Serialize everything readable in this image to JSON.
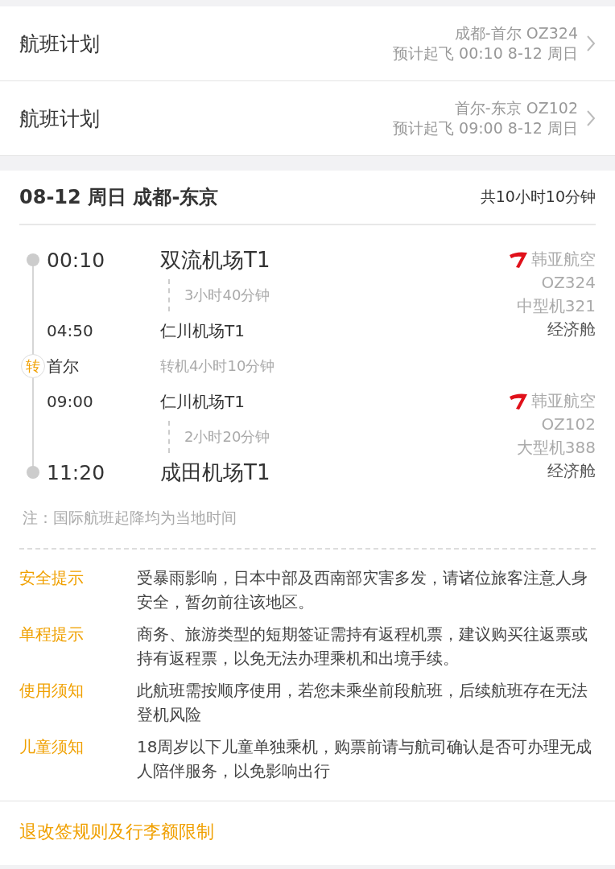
{
  "flight_plans": [
    {
      "title": "航班计划",
      "route": "成都-首尔 OZ324",
      "departure": "预计起飞 00:10 8-12 周日"
    },
    {
      "title": "航班计划",
      "route": "首尔-东京 OZ102",
      "departure": "预计起飞 09:00 8-12 周日"
    }
  ],
  "summary": {
    "date_route": "08-12 周日 成都-东京",
    "total": "共10小时10分钟"
  },
  "segments": [
    {
      "departure": {
        "time": "00:10",
        "airport": "双流机场T1"
      },
      "duration": "3小时40分钟",
      "arrival": {
        "time": "04:50",
        "airport": "仁川机场T1"
      },
      "airline": "韩亚航空",
      "flight_no": "OZ324",
      "aircraft": "中型机321",
      "cabin": "经济舱"
    },
    {
      "departure": {
        "time": "09:00",
        "airport": "仁川机场T1"
      },
      "duration": "2小时20分钟",
      "arrival": {
        "time": "11:20",
        "airport": "成田机场T1"
      },
      "airline": "韩亚航空",
      "flight_no": "OZ102",
      "aircraft": "大型机388",
      "cabin": "经济舱"
    }
  ],
  "transfer": {
    "badge": "转",
    "city": "首尔",
    "duration": "转机4小时10分钟"
  },
  "note": "注：国际航班起降均为当地时间",
  "notices": [
    {
      "label": "安全提示",
      "text": "受暴雨影响，日本中部及西南部灾害多发，请诸位旅客注意人身安全，暂勿前往该地区。"
    },
    {
      "label": "单程提示",
      "text": "商务、旅游类型的短期签证需持有返程机票，建议购买往返票或持有返程票，以免无法办理乘机和出境手续。"
    },
    {
      "label": "使用须知",
      "text": "此航班需按顺序使用，若您未乘坐前段航班，后续航班存在无法登机风险"
    },
    {
      "label": "儿童须知",
      "text": "18周岁以下儿童单独乘机，购票前请与航司确认是否可办理无成人陪伴服务，以免影响出行"
    }
  ],
  "footer_link": "退改签规则及行李额限制"
}
